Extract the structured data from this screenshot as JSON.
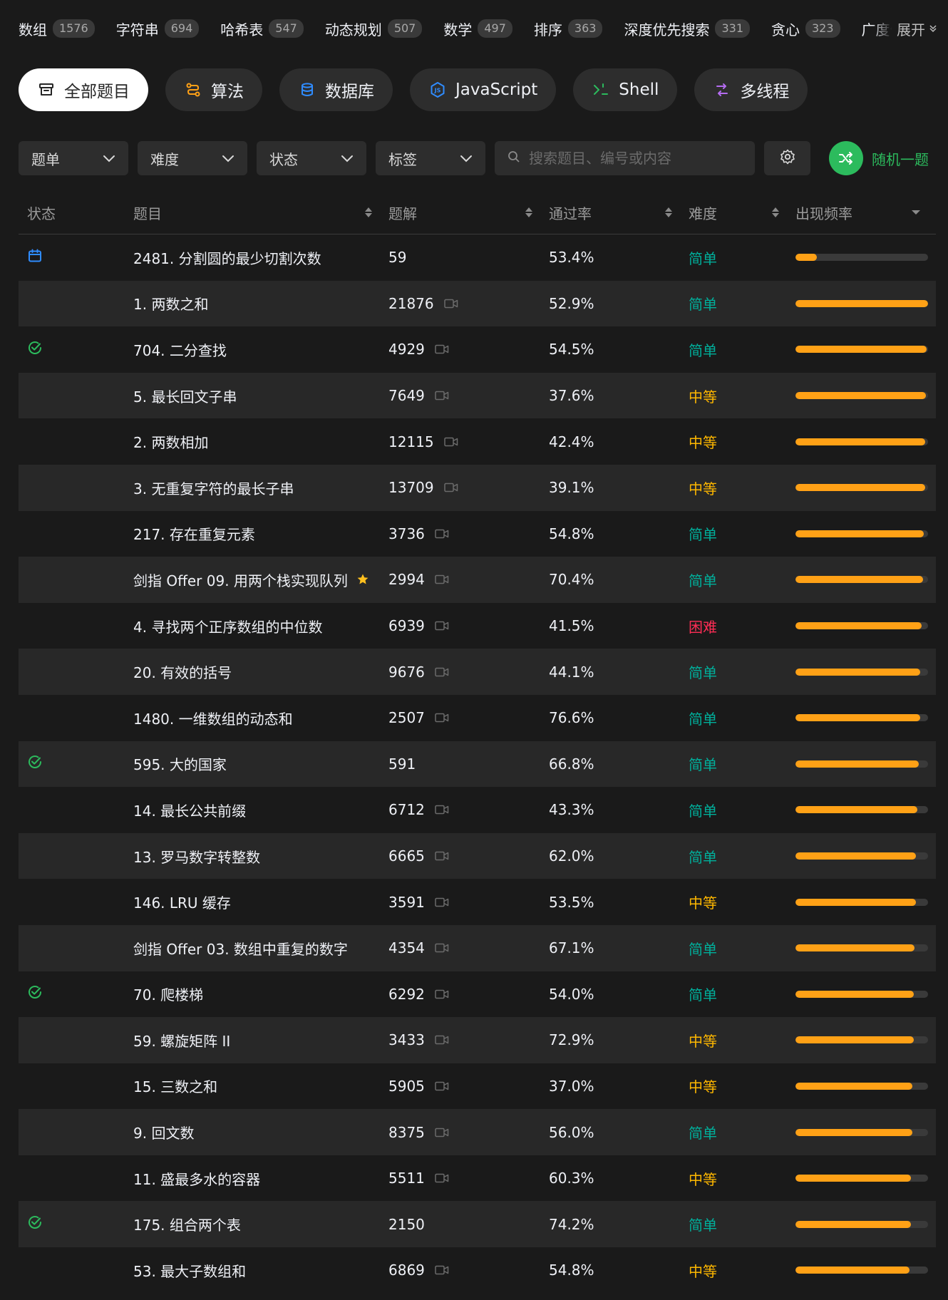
{
  "tags": [
    {
      "name": "数组",
      "count": "1576"
    },
    {
      "name": "字符串",
      "count": "694"
    },
    {
      "name": "哈希表",
      "count": "547"
    },
    {
      "name": "动态规划",
      "count": "507"
    },
    {
      "name": "数学",
      "count": "497"
    },
    {
      "name": "排序",
      "count": "363"
    },
    {
      "name": "深度优先搜索",
      "count": "331"
    },
    {
      "name": "贪心",
      "count": "323"
    },
    {
      "name": "广度优先搜索",
      "count": ""
    }
  ],
  "tags_expand_label": "展开",
  "categories": [
    {
      "label": "全部题目",
      "icon": "archive-icon",
      "color": "#262626",
      "active": true
    },
    {
      "label": "算法",
      "icon": "algorithm-icon",
      "color": "#ffa116",
      "active": false
    },
    {
      "label": "数据库",
      "icon": "database-icon",
      "color": "#2f8cff",
      "active": false
    },
    {
      "label": "JavaScript",
      "icon": "javascript-icon",
      "color": "#2f8cff",
      "active": false
    },
    {
      "label": "Shell",
      "icon": "shell-icon",
      "color": "#2cbb5d",
      "active": false
    },
    {
      "label": "多线程",
      "icon": "threads-icon",
      "color": "#b46cf0",
      "active": false
    }
  ],
  "filters": {
    "dropdowns": [
      "题单",
      "难度",
      "状态",
      "标签"
    ],
    "search_placeholder": "搜索题目、编号或内容",
    "random_label": "随机一题"
  },
  "columns": {
    "status": "状态",
    "title": "题目",
    "solutions": "题解",
    "rate": "通过率",
    "difficulty": "难度",
    "frequency": "出现频率"
  },
  "colors": {
    "easy": "#00af9b",
    "medium": "#ffb800",
    "hard": "#ff2d55",
    "accent": "#ffa116",
    "solved": "#2cbb5d",
    "daily": "#2f8cff"
  },
  "rows": [
    {
      "status": "daily",
      "title": "2481. 分割圆的最少切割次数",
      "solutions": "59",
      "video": false,
      "star": false,
      "rate": "53.4%",
      "difficulty": "简单",
      "level": "easy",
      "freq": 0.16
    },
    {
      "status": "",
      "title": "1. 两数之和",
      "solutions": "21876",
      "video": true,
      "star": false,
      "rate": "52.9%",
      "difficulty": "简单",
      "level": "easy",
      "freq": 1.0
    },
    {
      "status": "solved",
      "title": "704. 二分查找",
      "solutions": "4929",
      "video": true,
      "star": false,
      "rate": "54.5%",
      "difficulty": "简单",
      "level": "easy",
      "freq": 0.99
    },
    {
      "status": "",
      "title": "5. 最长回文子串",
      "solutions": "7649",
      "video": true,
      "star": false,
      "rate": "37.6%",
      "difficulty": "中等",
      "level": "medium",
      "freq": 0.985
    },
    {
      "status": "",
      "title": "2. 两数相加",
      "solutions": "12115",
      "video": true,
      "star": false,
      "rate": "42.4%",
      "difficulty": "中等",
      "level": "medium",
      "freq": 0.98
    },
    {
      "status": "",
      "title": "3. 无重复字符的最长子串",
      "solutions": "13709",
      "video": true,
      "star": false,
      "rate": "39.1%",
      "difficulty": "中等",
      "level": "medium",
      "freq": 0.98
    },
    {
      "status": "",
      "title": "217. 存在重复元素",
      "solutions": "3736",
      "video": true,
      "star": false,
      "rate": "54.8%",
      "difficulty": "简单",
      "level": "easy",
      "freq": 0.97
    },
    {
      "status": "",
      "title": "剑指 Offer 09. 用两个栈实现队列",
      "solutions": "2994",
      "video": true,
      "star": true,
      "rate": "70.4%",
      "difficulty": "简单",
      "level": "easy",
      "freq": 0.96
    },
    {
      "status": "",
      "title": "4. 寻找两个正序数组的中位数",
      "solutions": "6939",
      "video": true,
      "star": false,
      "rate": "41.5%",
      "difficulty": "困难",
      "level": "hard",
      "freq": 0.95
    },
    {
      "status": "",
      "title": "20. 有效的括号",
      "solutions": "9676",
      "video": true,
      "star": false,
      "rate": "44.1%",
      "difficulty": "简单",
      "level": "easy",
      "freq": 0.94
    },
    {
      "status": "",
      "title": "1480. 一维数组的动态和",
      "solutions": "2507",
      "video": true,
      "star": false,
      "rate": "76.6%",
      "difficulty": "简单",
      "level": "easy",
      "freq": 0.94
    },
    {
      "status": "solved",
      "title": "595. 大的国家",
      "solutions": "591",
      "video": false,
      "star": false,
      "rate": "66.8%",
      "difficulty": "简单",
      "level": "easy",
      "freq": 0.93
    },
    {
      "status": "",
      "title": "14. 最长公共前缀",
      "solutions": "6712",
      "video": true,
      "star": false,
      "rate": "43.3%",
      "difficulty": "简单",
      "level": "easy",
      "freq": 0.92
    },
    {
      "status": "",
      "title": "13. 罗马数字转整数",
      "solutions": "6665",
      "video": true,
      "star": false,
      "rate": "62.0%",
      "difficulty": "简单",
      "level": "easy",
      "freq": 0.91
    },
    {
      "status": "",
      "title": "146. LRU 缓存",
      "solutions": "3591",
      "video": true,
      "star": false,
      "rate": "53.5%",
      "difficulty": "中等",
      "level": "medium",
      "freq": 0.91
    },
    {
      "status": "",
      "title": "剑指 Offer 03. 数组中重复的数字",
      "solutions": "4354",
      "video": true,
      "star": false,
      "rate": "67.1%",
      "difficulty": "简单",
      "level": "easy",
      "freq": 0.9
    },
    {
      "status": "solved",
      "title": "70. 爬楼梯",
      "solutions": "6292",
      "video": true,
      "star": false,
      "rate": "54.0%",
      "difficulty": "简单",
      "level": "easy",
      "freq": 0.89
    },
    {
      "status": "",
      "title": "59. 螺旋矩阵 II",
      "solutions": "3433",
      "video": true,
      "star": false,
      "rate": "72.9%",
      "difficulty": "中等",
      "level": "medium",
      "freq": 0.89
    },
    {
      "status": "",
      "title": "15. 三数之和",
      "solutions": "5905",
      "video": true,
      "star": false,
      "rate": "37.0%",
      "difficulty": "中等",
      "level": "medium",
      "freq": 0.88
    },
    {
      "status": "",
      "title": "9. 回文数",
      "solutions": "8375",
      "video": true,
      "star": false,
      "rate": "56.0%",
      "difficulty": "简单",
      "level": "easy",
      "freq": 0.88
    },
    {
      "status": "",
      "title": "11. 盛最多水的容器",
      "solutions": "5511",
      "video": true,
      "star": false,
      "rate": "60.3%",
      "difficulty": "中等",
      "level": "medium",
      "freq": 0.87
    },
    {
      "status": "solved",
      "title": "175. 组合两个表",
      "solutions": "2150",
      "video": false,
      "star": false,
      "rate": "74.2%",
      "difficulty": "简单",
      "level": "easy",
      "freq": 0.87
    },
    {
      "status": "",
      "title": "53. 最大子数组和",
      "solutions": "6869",
      "video": true,
      "star": false,
      "rate": "54.8%",
      "difficulty": "中等",
      "level": "medium",
      "freq": 0.86
    }
  ]
}
